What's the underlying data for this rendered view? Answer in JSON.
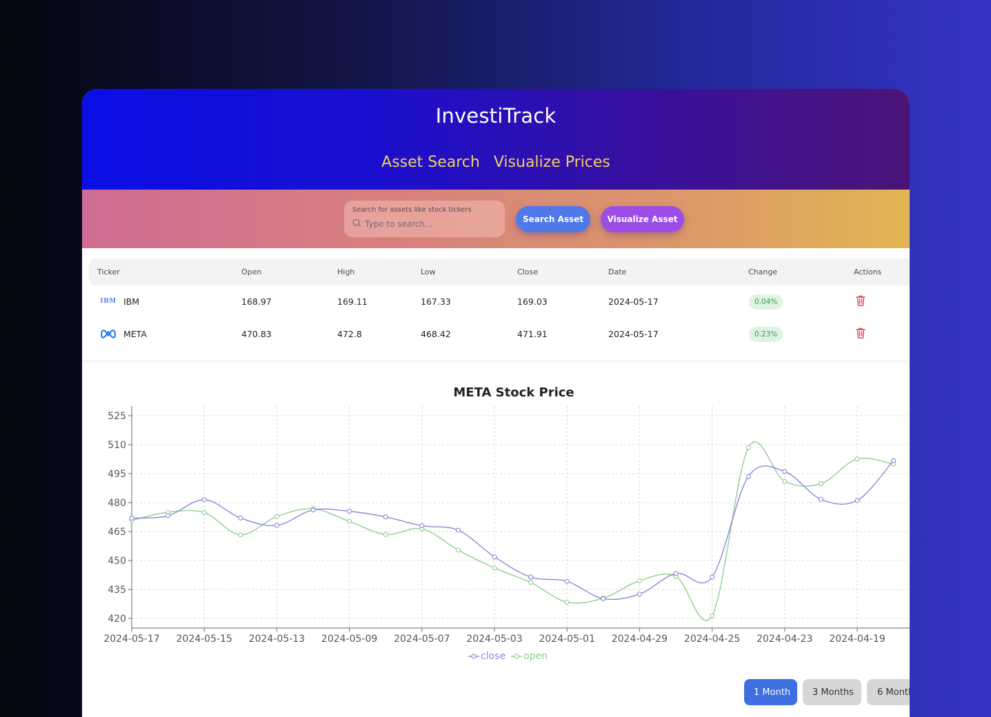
{
  "app": {
    "title": "InvestiTrack",
    "nav": [
      "Asset Search",
      "Visualize Prices"
    ]
  },
  "search": {
    "label": "Search for assets like stock tickers",
    "placeholder": "Type to search...",
    "search_button": "Search Asset",
    "visualize_button": "Visualize Asset"
  },
  "table": {
    "headers": [
      "Ticker",
      "Open",
      "High",
      "Low",
      "Close",
      "Date",
      "Change",
      "Actions"
    ],
    "rows": [
      {
        "logo": "IBM",
        "ticker": "IBM",
        "open": "168.97",
        "high": "169.11",
        "low": "167.33",
        "close": "169.03",
        "date": "2024-05-17",
        "change": "0.04%"
      },
      {
        "logo": "meta-logo-icon",
        "ticker": "META",
        "open": "470.83",
        "high": "472.8",
        "low": "468.42",
        "close": "471.91",
        "date": "2024-05-17",
        "change": "0.23%"
      }
    ]
  },
  "ranges": [
    "1 Month",
    "3 Months",
    "6 Months"
  ],
  "colors": {
    "close": "#8a86d8",
    "open": "#8fcc8f",
    "active_button": "#3d6fe0",
    "badge_bg": "#dff3e2",
    "badge_text": "#3a9a4a",
    "trash": "#e0425a"
  },
  "chart_data": {
    "type": "line",
    "title": "META Stock Price",
    "xlabel": "",
    "ylabel": "",
    "ylim": [
      415,
      530
    ],
    "yticks": [
      420,
      435,
      450,
      465,
      480,
      495,
      510,
      525
    ],
    "x": [
      "2024-05-17",
      "2024-05-16",
      "2024-05-15",
      "2024-05-14",
      "2024-05-13",
      "2024-05-10",
      "2024-05-09",
      "2024-05-08",
      "2024-05-07",
      "2024-05-06",
      "2024-05-03",
      "2024-05-02",
      "2024-05-01",
      "2024-04-30",
      "2024-04-29",
      "2024-04-26",
      "2024-04-25",
      "2024-04-24",
      "2024-04-23",
      "2024-04-22",
      "2024-04-19",
      "2024-04-18"
    ],
    "x_tick_labels": [
      "2024-05-17",
      "2024-05-15",
      "2024-05-13",
      "2024-05-09",
      "2024-05-07",
      "2024-05-03",
      "2024-05-01",
      "2024-04-29",
      "2024-04-25",
      "2024-04-23",
      "2024-04-19",
      "202"
    ],
    "series": [
      {
        "name": "close",
        "values": [
          471.9,
          473.2,
          481.5,
          472.0,
          468.2,
          476.2,
          475.5,
          472.6,
          468.0,
          465.7,
          451.9,
          441.4,
          439.2,
          430.2,
          432.6,
          443.3,
          441.4,
          493.5,
          496.1,
          481.7,
          481.1,
          501.8
        ]
      },
      {
        "name": "open",
        "values": [
          470.8,
          475.0,
          474.8,
          463.3,
          472.8,
          476.8,
          470.3,
          463.5,
          466.4,
          455.4,
          446.1,
          438.6,
          428.4,
          430.5,
          439.5,
          441.8,
          421.4,
          508.5,
          491.0,
          489.8,
          502.6,
          499.9
        ]
      }
    ],
    "grid": true,
    "legend": "bottom-center"
  }
}
